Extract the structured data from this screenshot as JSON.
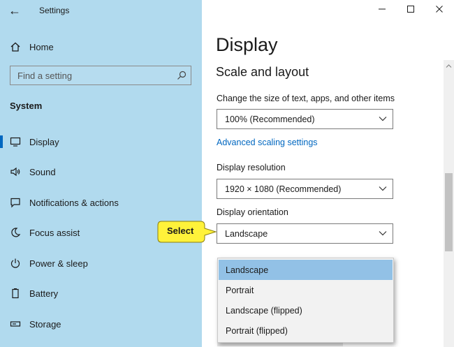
{
  "window": {
    "title": "Settings",
    "controls": [
      "minimize",
      "maximize",
      "close"
    ]
  },
  "sidebar": {
    "home_label": "Home",
    "search_placeholder": "Find a setting",
    "section_title": "System",
    "items": [
      {
        "label": "Display",
        "icon": "monitor-icon",
        "selected": true
      },
      {
        "label": "Sound",
        "icon": "speaker-icon",
        "selected": false
      },
      {
        "label": "Notifications & actions",
        "icon": "notification-icon",
        "selected": false
      },
      {
        "label": "Focus assist",
        "icon": "moon-icon",
        "selected": false
      },
      {
        "label": "Power & sleep",
        "icon": "power-icon",
        "selected": false
      },
      {
        "label": "Battery",
        "icon": "battery-icon",
        "selected": false
      },
      {
        "label": "Storage",
        "icon": "storage-icon",
        "selected": false
      }
    ]
  },
  "main": {
    "page_title": "Display",
    "section_heading": "Scale and layout",
    "scale_label": "Change the size of text, apps, and other items",
    "scale_value": "100% (Recommended)",
    "advanced_link": "Advanced scaling settings",
    "resolution_label": "Display resolution",
    "resolution_value": "1920 × 1080 (Recommended)",
    "orientation_label": "Display orientation",
    "orientation_value": "Landscape",
    "orientation_options": [
      {
        "label": "Landscape",
        "selected": true
      },
      {
        "label": "Portrait",
        "selected": false
      },
      {
        "label": "Landscape (flipped)",
        "selected": false
      },
      {
        "label": "Portrait (flipped)",
        "selected": false
      }
    ]
  },
  "callout": {
    "text": "Select",
    "color": "#fff23a"
  },
  "colors": {
    "sidebar_bg": "#b1daee",
    "accent": "#0067c0",
    "menu_selected": "#92c1e6"
  }
}
